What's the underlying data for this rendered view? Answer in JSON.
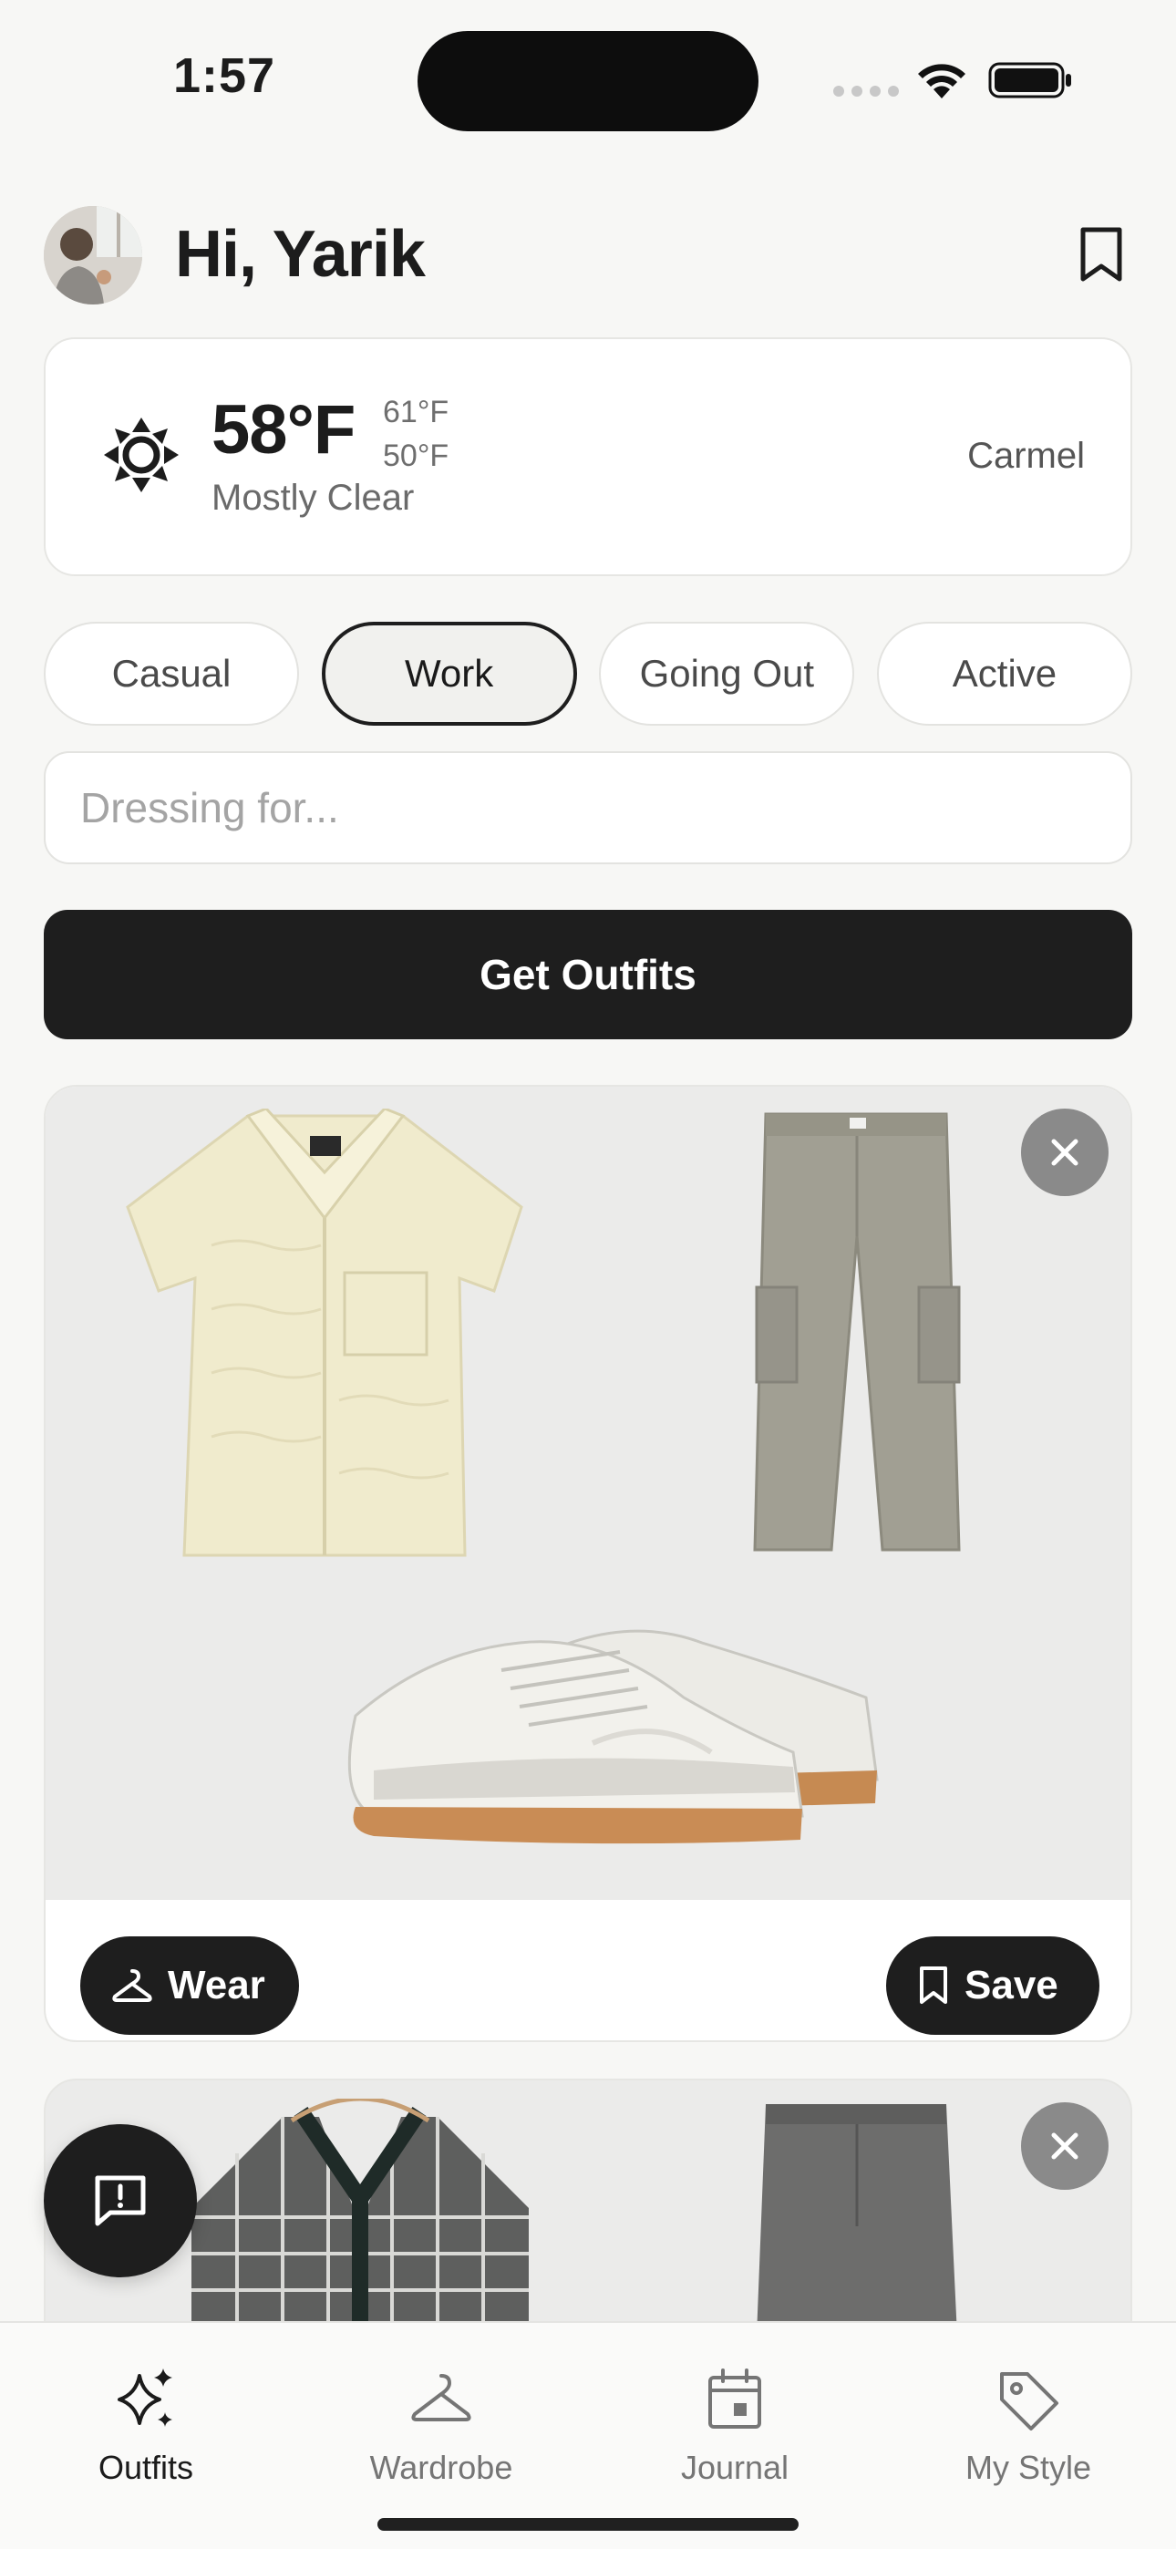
{
  "status_bar": {
    "time": "1:57"
  },
  "header": {
    "greeting": "Hi, Yarik"
  },
  "weather": {
    "temperature": "58°F",
    "high": "61°F",
    "low": "50°F",
    "condition": "Mostly Clear",
    "location": "Carmel"
  },
  "occasions": {
    "selected": "Work",
    "items": [
      "Casual",
      "Work",
      "Going Out",
      "Active"
    ]
  },
  "search": {
    "placeholder": "Dressing for...",
    "value": ""
  },
  "get_outfits_label": "Get Outfits",
  "outfit_card": {
    "items": [
      "cream-knit-shirt",
      "grey-cargo-pants",
      "white-gum-sneakers"
    ],
    "wear_label": "Wear",
    "save_label": "Save"
  },
  "outfit_card_2": {
    "items": [
      "plaid-knit-polo",
      "grey-trousers"
    ]
  },
  "tabs": [
    {
      "label": "Outfits",
      "icon": "sparkles-icon",
      "active": true
    },
    {
      "label": "Wardrobe",
      "icon": "hanger-icon",
      "active": false
    },
    {
      "label": "Journal",
      "icon": "calendar-icon",
      "active": false
    },
    {
      "label": "My Style",
      "icon": "tag-icon",
      "active": false
    }
  ],
  "colors": {
    "background": "#f7f7f5",
    "primary_button": "#1e1e1e",
    "card_media": "#ebebea"
  }
}
